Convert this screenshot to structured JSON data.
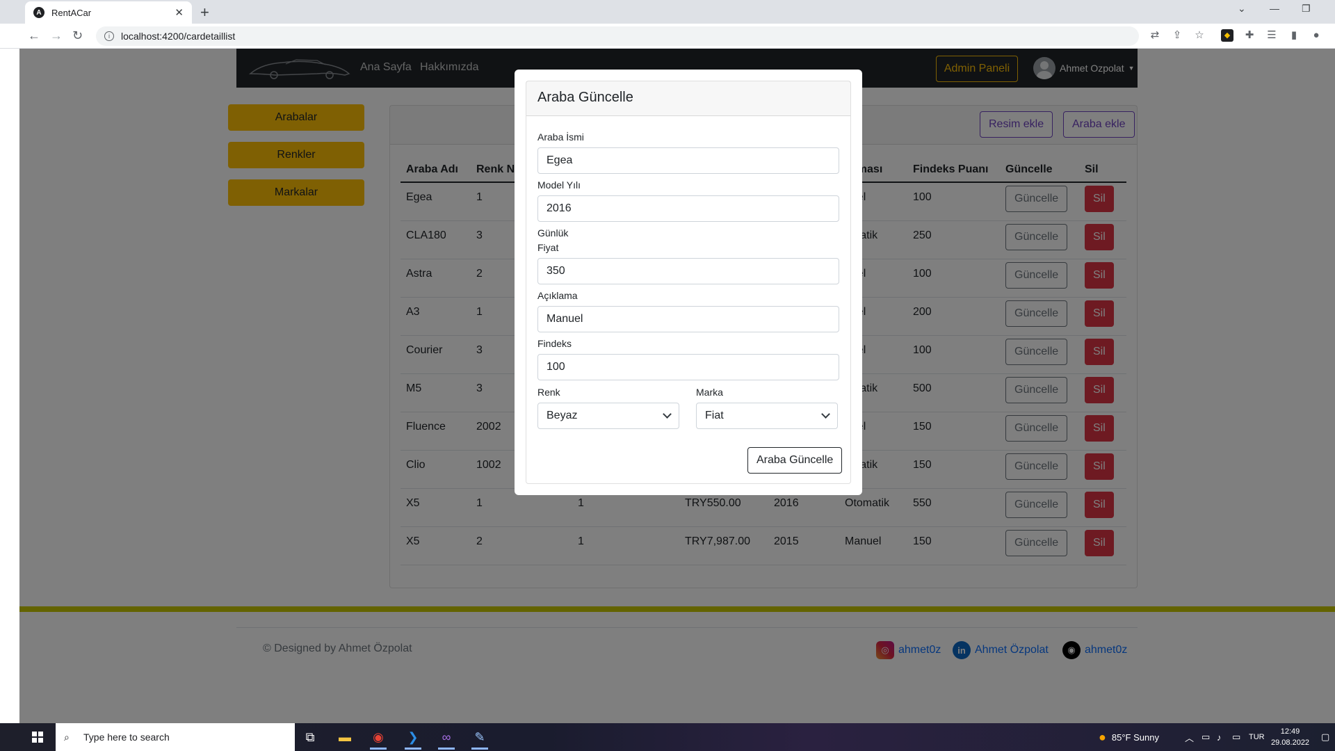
{
  "browser": {
    "tab_title": "RentACar",
    "favicon_letter": "A",
    "url": "localhost:4200/cardetaillist"
  },
  "navbar": {
    "links": [
      "Ana Sayfa",
      "Hakkımızda"
    ],
    "admin_button": "Admin Paneli",
    "user_name": "Ahmet Ozpolat"
  },
  "sidebar": {
    "items": [
      {
        "label": "Arabalar"
      },
      {
        "label": "Renkler"
      },
      {
        "label": "Markalar"
      }
    ]
  },
  "toolbar": {
    "add_image": "Resim ekle",
    "add_car": "Araba ekle"
  },
  "table": {
    "headers": [
      "Araba Adı",
      "Renk N",
      "",
      "",
      "",
      "ıklması",
      "Findeks Puanı",
      "Güncelle",
      "Sil"
    ],
    "rows": [
      {
        "name": "Egea",
        "color": "1",
        "brand": "",
        "price": "",
        "year": "",
        "gear": "nuel",
        "findeks": "100"
      },
      {
        "name": "CLA180",
        "color": "3",
        "brand": "",
        "price": "",
        "year": "",
        "gear": "omatik",
        "findeks": "250"
      },
      {
        "name": "Astra",
        "color": "2",
        "brand": "",
        "price": "",
        "year": "",
        "gear": "nuel",
        "findeks": "100"
      },
      {
        "name": "A3",
        "color": "1",
        "brand": "",
        "price": "",
        "year": "",
        "gear": "nuel",
        "findeks": "200"
      },
      {
        "name": "Courier",
        "color": "3",
        "brand": "",
        "price": "",
        "year": "",
        "gear": "nuel",
        "findeks": "100"
      },
      {
        "name": "M5",
        "color": "3",
        "brand": "",
        "price": "",
        "year": "",
        "gear": "omatik",
        "findeks": "500"
      },
      {
        "name": "Fluence",
        "color": "2002",
        "brand": "",
        "price": "",
        "year": "",
        "gear": "nuel",
        "findeks": "150"
      },
      {
        "name": "Clio",
        "color": "1002",
        "brand": "",
        "price": "",
        "year": "",
        "gear": "omatik",
        "findeks": "150"
      },
      {
        "name": "X5",
        "color": "1",
        "brand": "1",
        "price": "TRY550.00",
        "year": "2016",
        "gear": "Otomatik",
        "findeks": "550"
      },
      {
        "name": "X5",
        "color": "2",
        "brand": "1",
        "price": "TRY7,987.00",
        "year": "2015",
        "gear": "Manuel",
        "findeks": "150"
      }
    ],
    "update_label": "Güncelle",
    "delete_label": "Sil"
  },
  "modal": {
    "title": "Araba Güncelle",
    "fields": {
      "name_label": "Araba İsmi",
      "name_value": "Egea",
      "year_label": "Model Yılı",
      "year_value": "2016",
      "price_label_1": "Günlük",
      "price_label_2": "Fiyat",
      "price_value": "350",
      "desc_label": "Açıklama",
      "desc_value": "Manuel",
      "findeks_label": "Findeks",
      "findeks_value": "100",
      "color_label": "Renk",
      "color_value": "Beyaz",
      "brand_label": "Marka",
      "brand_value": "Fiat"
    },
    "submit": "Araba Güncelle"
  },
  "footer": {
    "copyright": "© Designed by Ahmet Özpolat",
    "instagram": "ahmet0z",
    "linkedin": "Ahmet Özpolat",
    "github": "ahmet0z"
  },
  "taskbar": {
    "search_placeholder": "Type here to search",
    "weather": "85°F  Sunny",
    "lang": "TUR",
    "time": "12:49",
    "date": "29.08.2022"
  },
  "colors": {
    "accent_yellow": "#ffc107",
    "danger": "#dc3545",
    "purple": "#6f42c1",
    "footer_line": "#c6c600"
  }
}
